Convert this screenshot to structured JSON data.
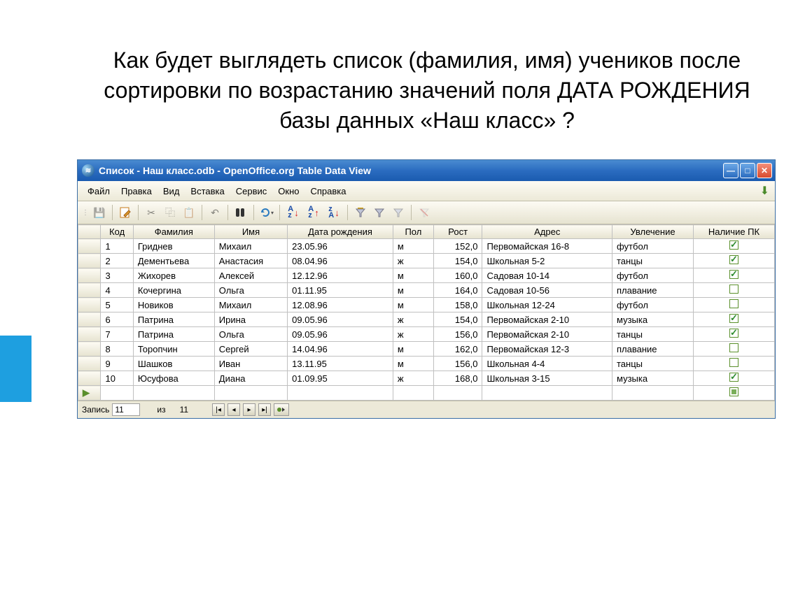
{
  "question": "Как будет выглядеть список (фамилия, имя) учеников после сортировки по возрастанию значений поля ДАТА РОЖДЕНИЯ базы данных «Наш класс» ?",
  "window": {
    "title": "Список - Наш класс.odb - OpenOffice.org Table Data View"
  },
  "menu": {
    "file": "Файл",
    "edit": "Правка",
    "view": "Вид",
    "insert": "Вставка",
    "tools": "Сервис",
    "window": "Окно",
    "help": "Справка"
  },
  "columns": {
    "code": "Код",
    "lastname": "Фамилия",
    "firstname": "Имя",
    "dob": "Дата рождения",
    "sex": "Пол",
    "height": "Рост",
    "address": "Адрес",
    "hobby": "Увлечение",
    "pc": "Наличие ПК"
  },
  "rows": [
    {
      "code": "1",
      "lastname": "Гриднев",
      "firstname": "Михаил",
      "dob": "23.05.96",
      "sex": "м",
      "height": "152,0",
      "address": "Первомайская 16-8",
      "hobby": "футбол",
      "pc": true
    },
    {
      "code": "2",
      "lastname": "Дементьева",
      "firstname": "Анастасия",
      "dob": "08.04.96",
      "sex": "ж",
      "height": "154,0",
      "address": "Школьная 5-2",
      "hobby": "танцы",
      "pc": true
    },
    {
      "code": "3",
      "lastname": "Жихорев",
      "firstname": "Алексей",
      "dob": "12.12.96",
      "sex": "м",
      "height": "160,0",
      "address": "Садовая 10-14",
      "hobby": "футбол",
      "pc": true
    },
    {
      "code": "4",
      "lastname": "Кочергина",
      "firstname": "Ольга",
      "dob": "01.11.95",
      "sex": "м",
      "height": "164,0",
      "address": "Садовая 10-56",
      "hobby": "плавание",
      "pc": false
    },
    {
      "code": "5",
      "lastname": "Новиков",
      "firstname": "Михаил",
      "dob": "12.08.96",
      "sex": "м",
      "height": "158,0",
      "address": "Школьная 12-24",
      "hobby": "футбол",
      "pc": false
    },
    {
      "code": "6",
      "lastname": "Патрина",
      "firstname": "Ирина",
      "dob": "09.05.96",
      "sex": "ж",
      "height": "154,0",
      "address": "Первомайская 2-10",
      "hobby": "музыка",
      "pc": true
    },
    {
      "code": "7",
      "lastname": "Патрина",
      "firstname": "Ольга",
      "dob": "09.05.96",
      "sex": "ж",
      "height": "156,0",
      "address": "Первомайская 2-10",
      "hobby": "танцы",
      "pc": true
    },
    {
      "code": "8",
      "lastname": "Торопчин",
      "firstname": "Сергей",
      "dob": "14.04.96",
      "sex": "м",
      "height": "162,0",
      "address": "Первомайская 12-3",
      "hobby": "плавание",
      "pc": false
    },
    {
      "code": "9",
      "lastname": "Шашков",
      "firstname": "Иван",
      "dob": "13.11.95",
      "sex": "м",
      "height": "156,0",
      "address": "Школьная 4-4",
      "hobby": "танцы",
      "pc": false
    },
    {
      "code": "10",
      "lastname": "Юсуфова",
      "firstname": "Диана",
      "dob": "01.09.95",
      "sex": "ж",
      "height": "168,0",
      "address": "Школьная 3-15",
      "hobby": "музыка",
      "pc": true
    }
  ],
  "record_nav": {
    "label": "Запись",
    "current": "11",
    "of_label": "из",
    "total": "11"
  }
}
